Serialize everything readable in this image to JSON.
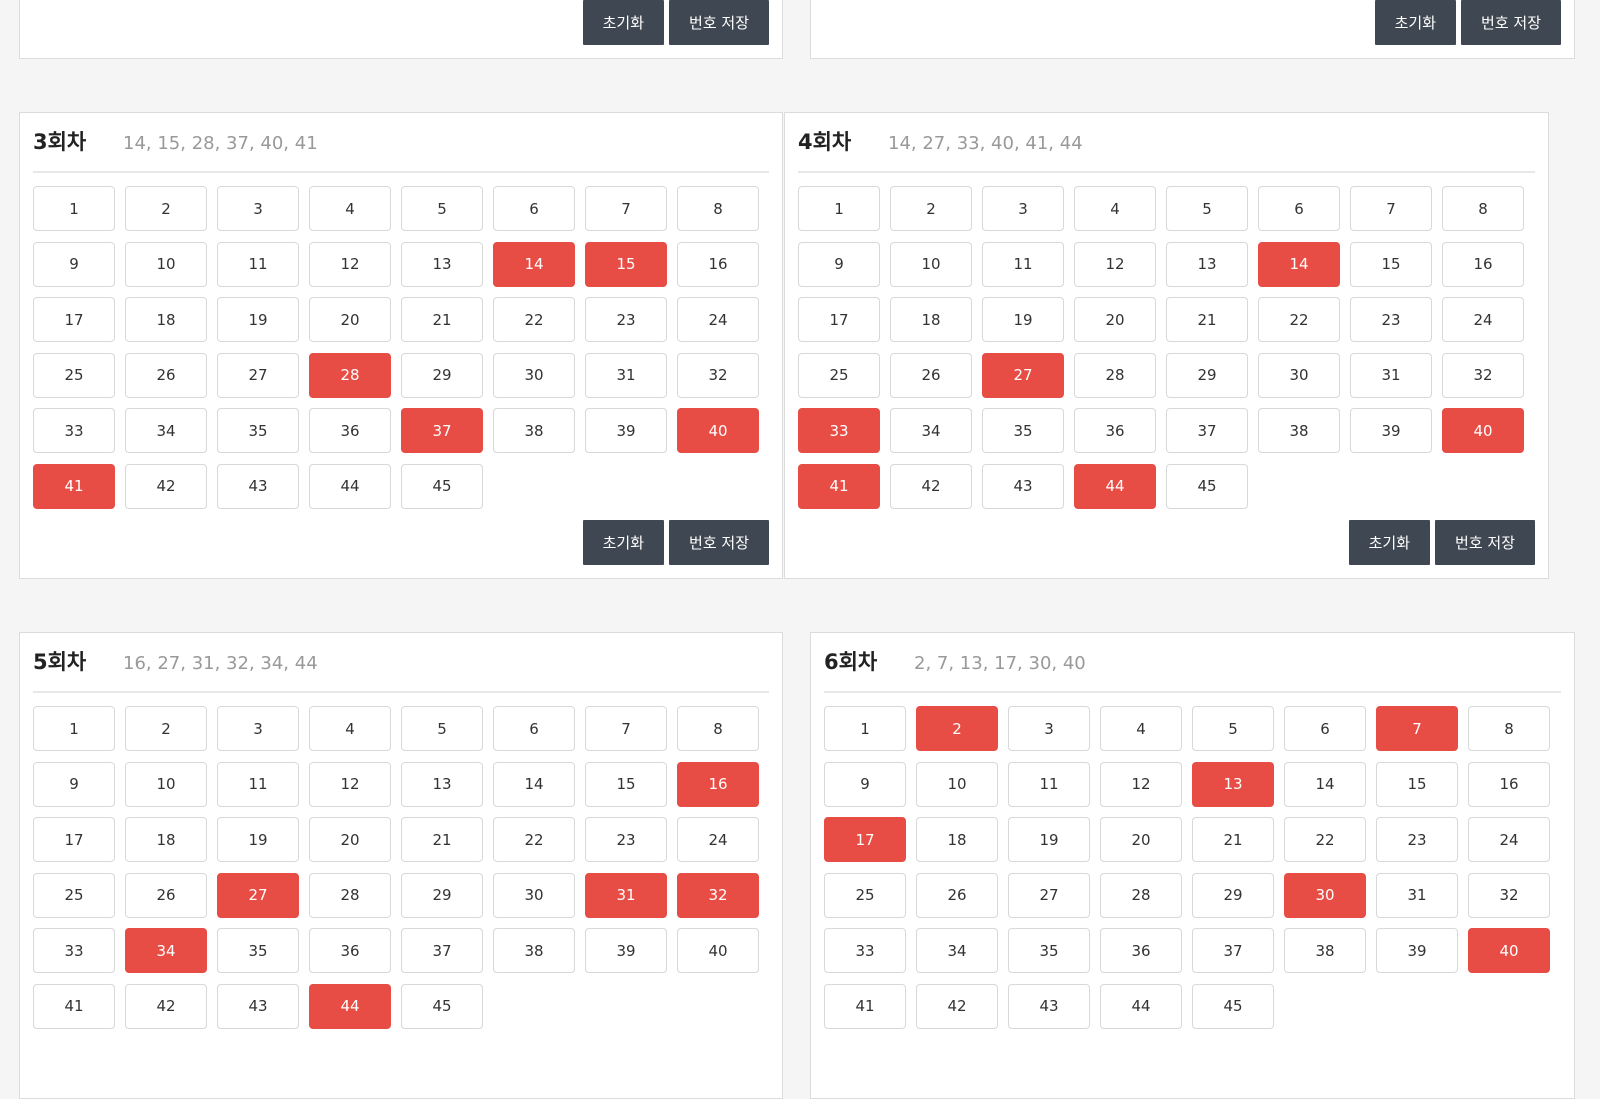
{
  "actions": {
    "reset_label": "초기화",
    "save_label": "번호 저장"
  },
  "rounds": [
    {
      "title": "",
      "numbers": "",
      "selected": [],
      "show_grid": false,
      "show_buttons": true
    },
    {
      "title": "",
      "numbers": "",
      "selected": [],
      "show_grid": false,
      "show_buttons": true
    },
    {
      "title": "3회차",
      "numbers": "14, 15, 28, 37, 40, 41",
      "selected": [
        14,
        15,
        28,
        37,
        40,
        41
      ],
      "show_grid": true,
      "show_buttons": true
    },
    {
      "title": "4회차",
      "numbers": "14, 27, 33, 40, 41, 44",
      "selected": [
        14,
        27,
        33,
        40,
        41,
        44
      ],
      "show_grid": true,
      "show_buttons": true
    },
    {
      "title": "5회차",
      "numbers": "16, 27, 31, 32, 34, 44",
      "selected": [
        16,
        27,
        31,
        32,
        34,
        44
      ],
      "show_grid": true,
      "show_buttons": false
    },
    {
      "title": "6회차",
      "numbers": "2, 7, 13, 17, 30, 40",
      "selected": [
        2,
        7,
        13,
        17,
        30,
        40
      ],
      "show_grid": true,
      "show_buttons": false
    }
  ],
  "ball_count": 45,
  "colors": {
    "selected": "#e74c45",
    "button": "#3f4752"
  }
}
